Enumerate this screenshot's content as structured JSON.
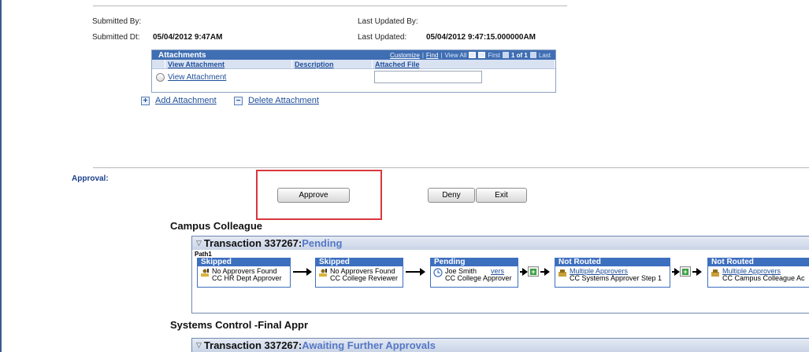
{
  "form": {
    "submitted_by_label": "Submitted By:",
    "submitted_dt_label": "Submitted Dt:",
    "submitted_dt_value": "05/04/2012  9:47AM",
    "last_updated_by_label": "Last Updated By:",
    "last_updated_label": "Last Updated:",
    "last_updated_value": "05/04/2012  9:47:15.000000AM"
  },
  "attachments": {
    "title": "Attachments",
    "customize": "Customize",
    "find": "Find",
    "view_all": "View All",
    "first": "First",
    "range": "1 of 1",
    "last": "Last",
    "columns": [
      "View Attachment",
      "Description",
      "Attached File"
    ],
    "row_link": "View Attachment",
    "add_label": "Add Attachment",
    "delete_label": "Delete Attachment"
  },
  "approval": {
    "label": "Approval:",
    "approve": "Approve",
    "deny": "Deny",
    "exit": "Exit"
  },
  "sections": [
    {
      "title": "Campus Colleague",
      "transaction_label": "Transaction 337267:",
      "transaction_status": "Pending",
      "path": "Path1",
      "steps": [
        {
          "status": "Skipped",
          "line1": "No Approvers Found",
          "line2": "CC HR Dept Approver"
        },
        {
          "status": "Skipped",
          "line1": "No Approvers Found",
          "line2": "CC College Reviewer"
        },
        {
          "status": "Pending",
          "line1": "Joe Smith",
          "line1_extra": "vers",
          "line2": "CC College Approver"
        },
        {
          "status": "Not Routed",
          "line1": "Multiple Approvers",
          "line2": "CC Systems Approver Step 1"
        },
        {
          "status": "Not Routed",
          "line1": "Multiple Approvers",
          "line2": "CC Campus Colleague Ac"
        }
      ]
    },
    {
      "title": "Systems Control -Final Appr",
      "transaction_label": "Transaction 337267:",
      "transaction_status": "Awaiting Further Approvals"
    }
  ],
  "colors": {
    "header_blue": "#3f6eb3",
    "step_blue": "#3d6fbf",
    "status_blue": "#5577c5",
    "highlight_red": "#d9373c"
  }
}
